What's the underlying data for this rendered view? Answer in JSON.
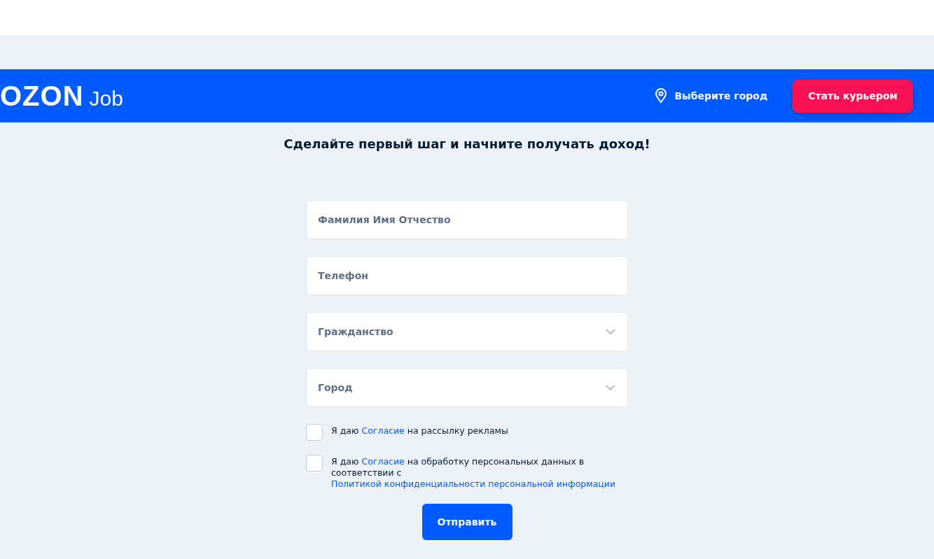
{
  "header": {
    "logo": "OZON",
    "logo_suffix": "Job",
    "city_link": "Выберите город",
    "cta_button": "Стать курьером"
  },
  "subtitle": "Сделайте первый шаг и начните получать доход!",
  "fields": [
    {
      "kind": "text",
      "placeholder": "Фамилия Имя Отчество"
    },
    {
      "kind": "text",
      "placeholder": "Телефон"
    },
    {
      "kind": "select",
      "placeholder": "Гражданство"
    },
    {
      "kind": "select",
      "placeholder": "Город"
    }
  ],
  "consents": [
    {
      "checked": false,
      "text_before": "Я даю",
      "link": "Согласие",
      "text_after": "на рассылку рекламы"
    },
    {
      "checked": false,
      "text_before": "Я даю",
      "link": "Согласие",
      "text_after": "на обработку персональных данных в соответствии с",
      "policy_link": "Политикой конфиденциальности персональной информации"
    }
  ],
  "submit_button": "Отправить"
}
